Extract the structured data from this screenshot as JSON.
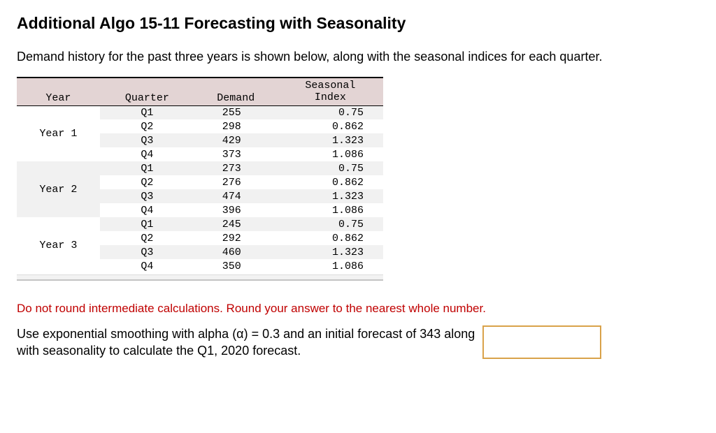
{
  "title": "Additional Algo 15-11 Forecasting with Seasonality",
  "intro": "Demand history for the past three years is shown below, along with the seasonal indices for each quarter.",
  "table": {
    "headers": {
      "year": "Year",
      "quarter": "Quarter",
      "demand": "Demand",
      "seasonal_index_line1": "Seasonal",
      "seasonal_index_line2": "Index"
    },
    "years": [
      {
        "label": "Year 1",
        "rows": [
          {
            "quarter": "Q1",
            "demand": "255",
            "seasonal_index": "0.75"
          },
          {
            "quarter": "Q2",
            "demand": "298",
            "seasonal_index": "0.862"
          },
          {
            "quarter": "Q3",
            "demand": "429",
            "seasonal_index": "1.323"
          },
          {
            "quarter": "Q4",
            "demand": "373",
            "seasonal_index": "1.086"
          }
        ]
      },
      {
        "label": "Year 2",
        "rows": [
          {
            "quarter": "Q1",
            "demand": "273",
            "seasonal_index": "0.75"
          },
          {
            "quarter": "Q2",
            "demand": "276",
            "seasonal_index": "0.862"
          },
          {
            "quarter": "Q3",
            "demand": "474",
            "seasonal_index": "1.323"
          },
          {
            "quarter": "Q4",
            "demand": "396",
            "seasonal_index": "1.086"
          }
        ]
      },
      {
        "label": "Year 3",
        "rows": [
          {
            "quarter": "Q1",
            "demand": "245",
            "seasonal_index": "0.75"
          },
          {
            "quarter": "Q2",
            "demand": "292",
            "seasonal_index": "0.862"
          },
          {
            "quarter": "Q3",
            "demand": "460",
            "seasonal_index": "1.323"
          },
          {
            "quarter": "Q4",
            "demand": "350",
            "seasonal_index": "1.086"
          }
        ]
      }
    ]
  },
  "warning": "Do not round intermediate calculations. Round your answer to the nearest whole number.",
  "prompt": "Use exponential smoothing with alpha (α) = 0.3 and an initial forecast of 343 along with seasonality to calculate the Q1, 2020 forecast.",
  "answer_value": ""
}
